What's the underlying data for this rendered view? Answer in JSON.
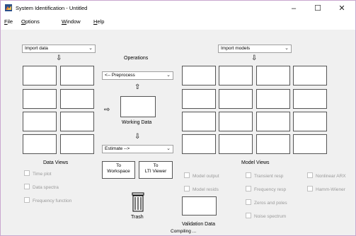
{
  "window": {
    "title": "System Identification - Untitled",
    "minimize": "–",
    "maximize": "☐",
    "close": "✕"
  },
  "menu": [
    {
      "label": "File",
      "mnemonic": "F",
      "rest": "ile"
    },
    {
      "label": "Options",
      "mnemonic": "O",
      "rest": "ptions"
    },
    {
      "label": "Window",
      "mnemonic": "W",
      "rest": "indow"
    },
    {
      "label": "Help",
      "mnemonic": "H",
      "rest": "elp"
    }
  ],
  "import_data": {
    "label": "Import data"
  },
  "import_models": {
    "label": "Import models"
  },
  "operations": {
    "title": "Operations",
    "preprocess": "<-- Preprocess",
    "estimate": "Estimate -->",
    "working_data_label": "Working Data"
  },
  "data_views": {
    "title": "Data Views",
    "options": [
      "Time plot",
      "Data spectra",
      "Frequency function"
    ]
  },
  "buttons": {
    "to_workspace": [
      "To",
      "Workspace"
    ],
    "to_lti_viewer": [
      "To",
      "LTI Viewer"
    ]
  },
  "trash_label": "Trash",
  "validation_data_label": "Validation Data",
  "model_views": {
    "title": "Model Views",
    "col1": [
      "Model output",
      "Model resids"
    ],
    "col2": [
      "Transient resp",
      "Frequency resp",
      "Zeros and poles",
      "Noise spectrum"
    ],
    "col3": [
      "Nonlinear ARX",
      "Hamm-Wiener"
    ]
  },
  "status": "Compiling ...",
  "colors": {
    "disabled_text": "#9a9a9a",
    "panel_bg": "#f0f0f0",
    "window_border": "#c9a7cf"
  },
  "icons": {
    "app": "matlab-ident-icon",
    "trash": "trash-icon"
  }
}
